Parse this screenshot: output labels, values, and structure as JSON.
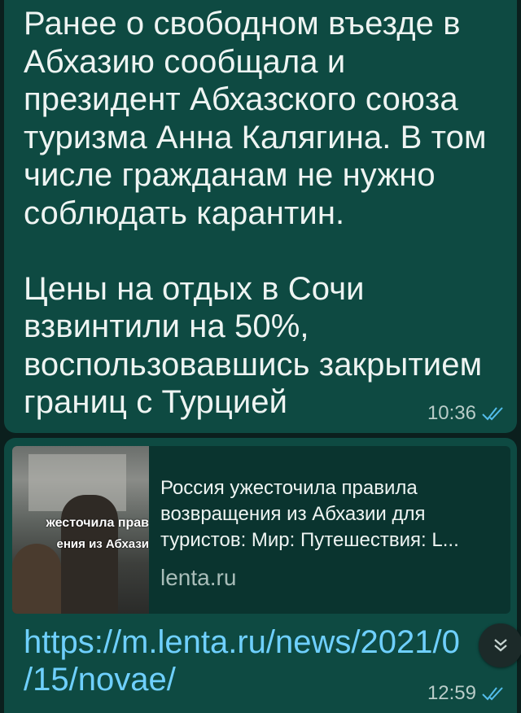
{
  "message_1": {
    "cut_line": "",
    "text": "Ранее о свободном въезде в\nАбхазию сообщала и\nпрезидент Абхазского союза\nтуризма Анна Калягина. В том\nчисле гражданам не нужно\nсоблюдать карантин.\n\nЦены на отдых в Сочи\nвзвинтили на 50%,\nвоспользовавшись закрытием\nграниц с Турцией",
    "time": "10:36"
  },
  "message_2": {
    "preview": {
      "thumb_caption_1": "жесточила прав",
      "thumb_caption_2": "ения из Абхази",
      "title": "Россия ужесточила правила\nвозвращения из Абхазии для\nтуристов: Мир: Путешествия: L...",
      "domain": "lenta.ru"
    },
    "link": "https://m.lenta.ru/news/2021/0\n/15/novae/",
    "time": "12:59"
  },
  "colors": {
    "bubble": "#0e4a42",
    "link": "#6fd0ff",
    "read_check": "#53bdeb"
  },
  "icons": [
    "double-check-icon",
    "chevron-down-double-icon"
  ]
}
